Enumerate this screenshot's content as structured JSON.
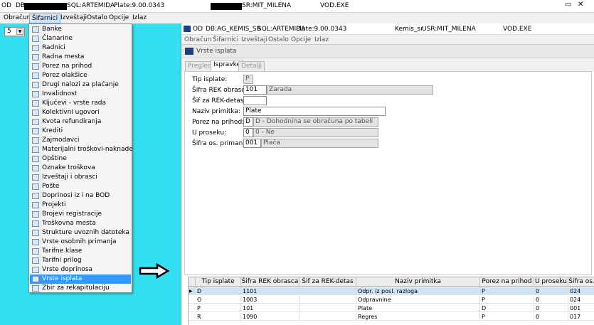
{
  "outer_title": {
    "od": "OD",
    "db": "DB",
    "sql": "SQL:ARTEMIDA",
    "plate": "Plate:9.00.0343",
    "usr": "SR:MIT_MILENA",
    "exe": "VOD.EXE"
  },
  "outer_menu": [
    "Obračun",
    "Šifarnici",
    "Izveštaji",
    "Ostalo",
    "Opcije",
    "Izlaz"
  ],
  "select_value": "5",
  "dropdown_items": [
    "Banke",
    "Članarine",
    "Radnici",
    "Radna mesta",
    "Porez na prihod",
    "Porez olakšice",
    "Drugi nalozi za plaćanje",
    "Invalidnost",
    "Ključevi - vrste rada",
    "Kolektivni ugovori",
    "Kvota refundiranja",
    "Krediti",
    "Zajmodavci",
    "Materijalni troškovi-naknade",
    "Opštine",
    "Oznake troškova",
    "Izveštaji i obrasci",
    "Pošte",
    "Doprinosi iz i na BOD",
    "Projekti",
    "Brojevi registracije",
    "Troškovna mesta",
    "Strukture uvoznih datoteka",
    "Vrste osobnih primanja",
    "Tarifne klase",
    "Tarifni prilog",
    "Vrste doprinosa",
    "Vrste isplata",
    "Zbir za rekapitulaciju"
  ],
  "dropdown_selected_index": 27,
  "inner_title": {
    "od": "OD",
    "db": "DB:AG_KEMIS_SR",
    "sql": "SQL:ARTEMIDA",
    "plate": "Plate:9.00.0343",
    "user": "Kemis_sr",
    "usr": "USR:MIT_MILENA",
    "exe": "VOD.EXE"
  },
  "inner_menu": [
    "Obračun",
    "Šifarnici",
    "Izveštaji",
    "Ostalo",
    "Opcije",
    "Izlaz"
  ],
  "subwindow_title": "Vrste isplata",
  "tabs": [
    "Pregled",
    "Ispravke",
    "Detalji"
  ],
  "active_tab": 1,
  "form": {
    "tip_isplate": {
      "label": "Tip isplate:",
      "value": "P"
    },
    "sifra_rek": {
      "label": "Šifra REK obrasca:",
      "code": "101",
      "desc": "Zarada"
    },
    "sif_rek_detas": {
      "label": "Šif za REK-detas:",
      "value": ""
    },
    "naziv_primitka": {
      "label": "Naziv primitka:",
      "value": "Plate"
    },
    "porez_na_prihod": {
      "label": "Porez na prihod:",
      "code": "D",
      "desc": "D - Dohodnina se obračuna po tabeli"
    },
    "u_proseku": {
      "label": "U proseku:",
      "code": "0",
      "desc": "0 - Ne"
    },
    "sifra_os_primanja": {
      "label": "Šifra os. primanja:",
      "code": "001",
      "desc": "Plača"
    }
  },
  "grid": {
    "columns": [
      "Tip isplate",
      "Šifra REK obrasca",
      "Šif za REK-detas",
      "Naziv primitka",
      "Porez na prihod",
      "U proseku",
      "Šifra os."
    ],
    "rows": [
      [
        "D",
        "1101",
        "",
        "Odpr. iz posl. razloga",
        "P",
        "0",
        "024"
      ],
      [
        "O",
        "1003",
        "",
        "Odpravnine",
        "P",
        "0",
        "024"
      ],
      [
        "P",
        "101",
        "",
        "Plate",
        "D",
        "0",
        "001"
      ],
      [
        "R",
        "1090",
        "",
        "Regres",
        "P",
        "0",
        "017"
      ]
    ]
  },
  "colors": {
    "background": "#33e0ef",
    "selected": "#3399ff"
  }
}
